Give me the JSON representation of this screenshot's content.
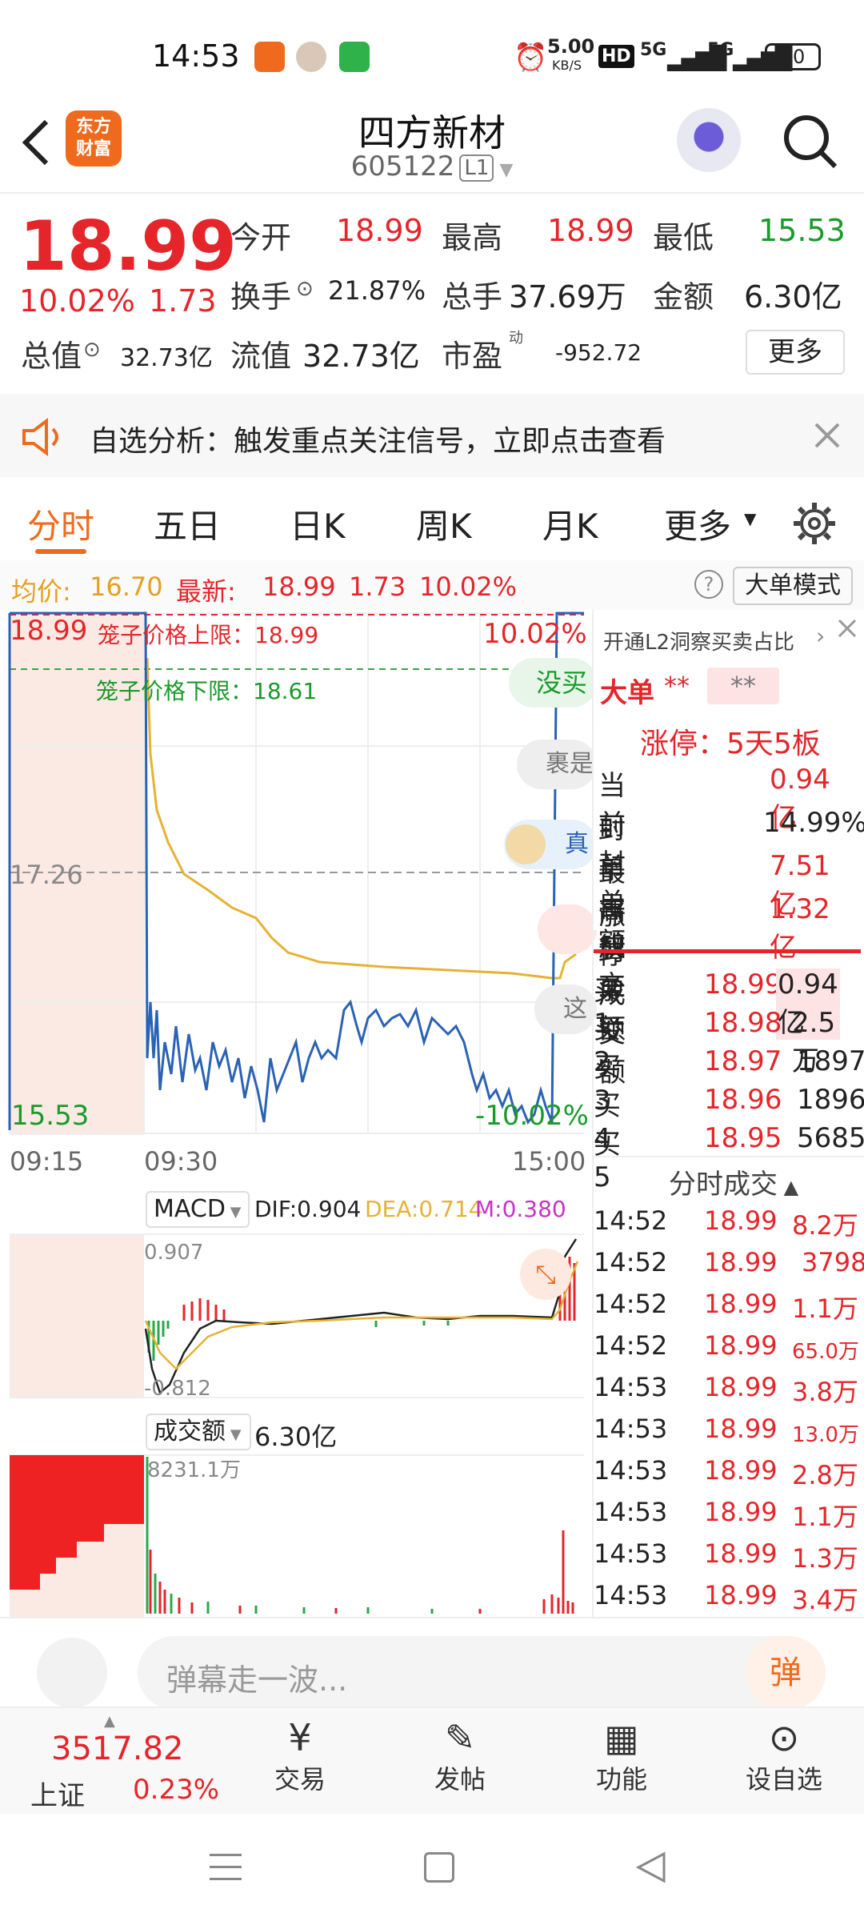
{
  "status_bar": {
    "time": "14:53",
    "net_speed": "5.00",
    "net_unit": "KB/S",
    "hd_label": "HD",
    "signal1": "5G",
    "signal2": "5G",
    "battery": "60"
  },
  "header": {
    "logo_text_line1": "东方",
    "logo_text_line2": "财富",
    "stock_name": "四方新材",
    "stock_code": "605122",
    "level_badge": "L1"
  },
  "quote": {
    "price": "18.99",
    "change_pct": "10.02%",
    "change": "1.73",
    "open_label": "今开",
    "open": "18.99",
    "high_label": "最高",
    "high": "18.99",
    "low_label": "最低",
    "low": "15.53",
    "turnover_label": "换手",
    "turnover": "21.87%",
    "volume_label": "总手",
    "volume": "37.69万",
    "amount_label": "金额",
    "amount": "6.30亿",
    "mktcap_label": "总值",
    "mktcap": "32.73亿",
    "float_label": "流值",
    "float_cap": "32.73亿",
    "pe_label": "市盈",
    "pe_sup": "动",
    "pe": "-952.72",
    "more_button": "更多"
  },
  "notice": {
    "text": "自选分析：触发重点关注信号，立即点击查看"
  },
  "tabs": [
    {
      "label": "分时"
    },
    {
      "label": "五日"
    },
    {
      "label": "日K"
    },
    {
      "label": "周K"
    },
    {
      "label": "月K"
    },
    {
      "label": "更多"
    }
  ],
  "info_line": {
    "avg_label": "均价:",
    "avg": "16.70",
    "latest_label": "最新:",
    "latest": "18.99",
    "chg": "1.73",
    "pct": "10.02%",
    "mode_button": "大单模式"
  },
  "chart": {
    "price_top": "18.99",
    "pct_top": "10.02%",
    "mid_price": "17.26",
    "price_bottom": "15.53",
    "pct_bottom": "-10.02%",
    "upper_limit": "笼子价格上限：18.99",
    "lower_limit": "笼子价格下限：18.61",
    "time_start": "09:15",
    "time_open": "09:30",
    "time_end": "15:00",
    "float_btn1": "没买",
    "float_btn2": "裹是",
    "float_btn3": "真",
    "float_btn4": "这",
    "macd_label": "MACD",
    "dif": "DIF:0.904",
    "dea": "DEA:0.714",
    "m": "M:0.380",
    "macd_top": "0.907",
    "macd_bottom": "-0.812",
    "vol_label": "成交额",
    "vol_total": "6.30亿",
    "vol_max": "8231.1万"
  },
  "l2_panel": {
    "promo": "开通L2洞察买卖占比",
    "big_order": "大单",
    "masked1": "**",
    "masked2": "**",
    "limit_title": "涨停：5天5板",
    "rows": [
      {
        "label": "当前封单额",
        "value": "0.94亿"
      },
      {
        "label": "封单占成交",
        "value": "14.99%"
      },
      {
        "label": "最高封单额",
        "value": "7.51亿"
      },
      {
        "label": "涨停成交额",
        "value": "1.32亿"
      }
    ]
  },
  "order_book": [
    {
      "label": "买1",
      "price": "18.99",
      "vol": "0.94亿"
    },
    {
      "label": "买2",
      "price": "18.98",
      "vol": "2.5万"
    },
    {
      "label": "买3",
      "price": "18.97",
      "vol": "1897"
    },
    {
      "label": "买4",
      "price": "18.96",
      "vol": "1896"
    },
    {
      "label": "买5",
      "price": "18.95",
      "vol": "5685"
    }
  ],
  "trades_title": "分时成交",
  "trades": [
    {
      "time": "14:52",
      "price": "18.99",
      "vol": "8.2万"
    },
    {
      "time": "14:52",
      "price": "18.99",
      "vol": "3798"
    },
    {
      "time": "14:52",
      "price": "18.99",
      "vol": "1.1万"
    },
    {
      "time": "14:52",
      "price": "18.99",
      "vol": "65.0万"
    },
    {
      "time": "14:53",
      "price": "18.99",
      "vol": "3.8万"
    },
    {
      "time": "14:53",
      "price": "18.99",
      "vol": "13.0万"
    },
    {
      "time": "14:53",
      "price": "18.99",
      "vol": "2.8万"
    },
    {
      "time": "14:53",
      "price": "18.99",
      "vol": "1.1万"
    },
    {
      "time": "14:53",
      "price": "18.99",
      "vol": "1.3万"
    },
    {
      "time": "14:53",
      "price": "18.99",
      "vol": "3.4万"
    }
  ],
  "danmu": {
    "placeholder": "弹幕走一波...",
    "send_icon_text": "弹"
  },
  "bottom_bar": {
    "index_value": "3517.82",
    "index_name": "上证",
    "index_pct": "0.23%",
    "items": [
      {
        "label": "交易"
      },
      {
        "label": "发帖"
      },
      {
        "label": "功能"
      },
      {
        "label": "设自选"
      }
    ]
  },
  "colors": {
    "up": "#e4262b",
    "down": "#1a9a2a",
    "accent": "#f06a1d",
    "price_line": "#2a62b4",
    "avg_line": "#e5b233"
  }
}
